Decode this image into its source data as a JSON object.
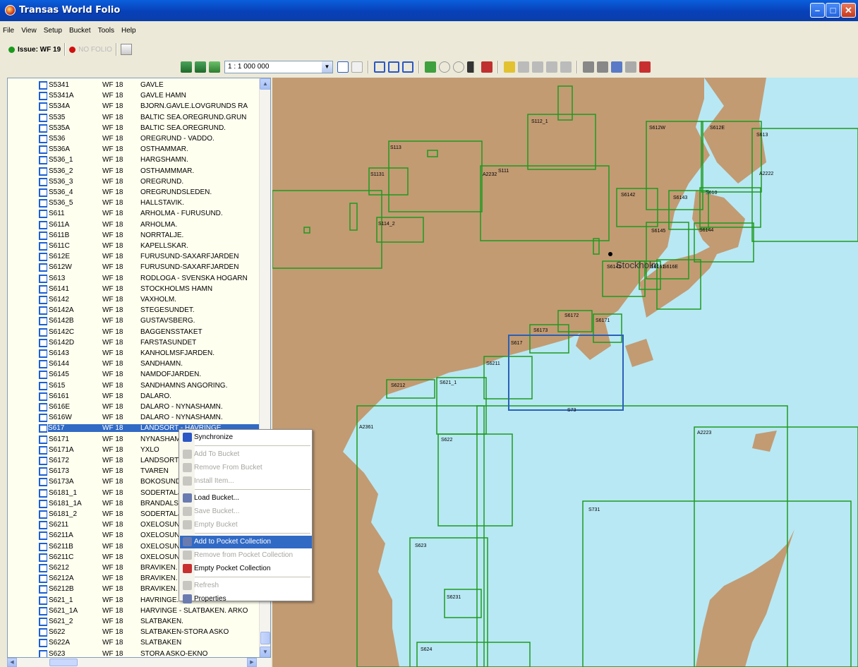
{
  "window": {
    "title": "Transas World Folio"
  },
  "menu": [
    "File",
    "View",
    "Setup",
    "Bucket",
    "Tools",
    "Help"
  ],
  "toolbar": {
    "issue_label": "Issue: WF 19",
    "issue_color": "#1a9a1a",
    "nofolio_label": "NO FOLIO",
    "nofolio_color": "#d01010",
    "scale_value": "1 : 1 000 000"
  },
  "list": {
    "rows": [
      {
        "code": "S5341",
        "ver": "WF 18",
        "name": "GAVLE"
      },
      {
        "code": "S5341A",
        "ver": "WF 18",
        "name": "GAVLE HAMN"
      },
      {
        "code": "S534A",
        "ver": "WF 18",
        "name": "BJORN.GAVLE.LOVGRUNDS RA"
      },
      {
        "code": "S535",
        "ver": "WF 18",
        "name": "BALTIC SEA.OREGRUND.GRUN"
      },
      {
        "code": "S535A",
        "ver": "WF 18",
        "name": "BALTIC SEA.OREGRUND."
      },
      {
        "code": "S536",
        "ver": "WF 18",
        "name": "OREGRUND - VADDO."
      },
      {
        "code": "S536A",
        "ver": "WF 18",
        "name": "OSTHAMMAR."
      },
      {
        "code": "S536_1",
        "ver": "WF 18",
        "name": "HARGSHAMN."
      },
      {
        "code": "S536_2",
        "ver": "WF 18",
        "name": "OSTHAMMMAR."
      },
      {
        "code": "S536_3",
        "ver": "WF 18",
        "name": "OREGRUND."
      },
      {
        "code": "S536_4",
        "ver": "WF 18",
        "name": "OREGRUNDSLEDEN."
      },
      {
        "code": "S536_5",
        "ver": "WF 18",
        "name": "HALLSTAVIK."
      },
      {
        "code": "S611",
        "ver": "WF 18",
        "name": "ARHOLMA - FURUSUND."
      },
      {
        "code": "S611A",
        "ver": "WF 18",
        "name": "ARHOLMA."
      },
      {
        "code": "S611B",
        "ver": "WF 18",
        "name": "NORRTALJE."
      },
      {
        "code": "S611C",
        "ver": "WF 18",
        "name": "KAPELLSKAR."
      },
      {
        "code": "S612E",
        "ver": "WF 18",
        "name": "FURUSUND-SAXARFJARDEN"
      },
      {
        "code": "S612W",
        "ver": "WF 18",
        "name": "FURUSUND-SAXARFJARDEN"
      },
      {
        "code": "S613",
        "ver": "WF 18",
        "name": "RODLOGA - SVENSKA HOGARN"
      },
      {
        "code": "S6141",
        "ver": "WF 18",
        "name": "STOCKHOLMS HAMN"
      },
      {
        "code": "S6142",
        "ver": "WF 18",
        "name": "VAXHOLM."
      },
      {
        "code": "S6142A",
        "ver": "WF 18",
        "name": "STEGESUNDET."
      },
      {
        "code": "S6142B",
        "ver": "WF 18",
        "name": "GUSTAVSBERG."
      },
      {
        "code": "S6142C",
        "ver": "WF 18",
        "name": "BAGGENSSTAKET"
      },
      {
        "code": "S6142D",
        "ver": "WF 18",
        "name": "FARSTASUNDET"
      },
      {
        "code": "S6143",
        "ver": "WF 18",
        "name": "KANHOLMSFJARDEN."
      },
      {
        "code": "S6144",
        "ver": "WF 18",
        "name": "SANDHAMN."
      },
      {
        "code": "S6145",
        "ver": "WF 18",
        "name": "NAMDOFJARDEN."
      },
      {
        "code": "S615",
        "ver": "WF 18",
        "name": "SANDHAMNS ANGORING."
      },
      {
        "code": "S6161",
        "ver": "WF 18",
        "name": "DALARO."
      },
      {
        "code": "S616E",
        "ver": "WF 18",
        "name": "DALARO - NYNASHAMN."
      },
      {
        "code": "S616W",
        "ver": "WF 18",
        "name": "DALARO - NYNASHAMN."
      },
      {
        "code": "S617",
        "ver": "WF 18",
        "name": "LANDSORT - HAVRINGE",
        "selected": true
      },
      {
        "code": "S6171",
        "ver": "WF 18",
        "name": "NYNASHAMN."
      },
      {
        "code": "S6171A",
        "ver": "WF 18",
        "name": "YXLO"
      },
      {
        "code": "S6172",
        "ver": "WF 18",
        "name": "LANDSORT."
      },
      {
        "code": "S6173",
        "ver": "WF 18",
        "name": "TVAREN"
      },
      {
        "code": "S6173A",
        "ver": "WF 18",
        "name": "BOKOSUNDET."
      },
      {
        "code": "S6181_1",
        "ver": "WF 18",
        "name": "SODERTALJE."
      },
      {
        "code": "S6181_1A",
        "ver": "WF 18",
        "name": "BRANDALSUND."
      },
      {
        "code": "S6181_2",
        "ver": "WF 18",
        "name": "SODERTALJE."
      },
      {
        "code": "S6211",
        "ver": "WF 18",
        "name": "OXELOSUND."
      },
      {
        "code": "S6211A",
        "ver": "WF 18",
        "name": "OXELOSUND."
      },
      {
        "code": "S6211B",
        "ver": "WF 18",
        "name": "OXELOSUND."
      },
      {
        "code": "S6211C",
        "ver": "WF 18",
        "name": "OXELOSUND."
      },
      {
        "code": "S6212",
        "ver": "WF 18",
        "name": "BRAVIKEN."
      },
      {
        "code": "S6212A",
        "ver": "WF 18",
        "name": "BRAVIKEN."
      },
      {
        "code": "S6212B",
        "ver": "WF 18",
        "name": "BRAVIKEN."
      },
      {
        "code": "S621_1",
        "ver": "WF 18",
        "name": "HAVRINGE."
      },
      {
        "code": "S621_1A",
        "ver": "WF 18",
        "name": "HARVINGE - SLATBAKEN. ARKO"
      },
      {
        "code": "S621_2",
        "ver": "WF 18",
        "name": "SLATBAKEN."
      },
      {
        "code": "S622",
        "ver": "WF 18",
        "name": "SLATBAKEN-STORA ASKO"
      },
      {
        "code": "S622A",
        "ver": "WF 18",
        "name": "SLATBAKEN"
      },
      {
        "code": "S623",
        "ver": "WF 18",
        "name": "STORA ASKO-EKNO"
      }
    ]
  },
  "context_menu": {
    "items": [
      {
        "label": "Synchronize",
        "disabled": false,
        "icon": "play-icon"
      },
      {
        "label": "Add To Bucket",
        "disabled": true,
        "icon": "bucket-add-icon"
      },
      {
        "label": "Remove From Bucket",
        "disabled": true,
        "icon": "bucket-remove-icon"
      },
      {
        "label": "Install Item...",
        "disabled": true,
        "icon": "install-icon"
      },
      {
        "label": "Load Bucket...",
        "disabled": false,
        "icon": "bucket-load-icon"
      },
      {
        "label": "Save Bucket...",
        "disabled": true,
        "icon": "bucket-save-icon"
      },
      {
        "label": "Empty Bucket",
        "disabled": true,
        "icon": "bucket-empty-icon"
      },
      {
        "label": "Add to Pocket Collection",
        "disabled": false,
        "icon": "pocket-add-icon",
        "highlighted": true
      },
      {
        "label": "Remove from Pocket Collection",
        "disabled": true,
        "icon": "pocket-remove-icon"
      },
      {
        "label": "Empty Pocket Collection",
        "disabled": false,
        "icon": "pocket-empty-icon"
      },
      {
        "label": "Refresh",
        "disabled": true,
        "icon": "refresh-icon"
      },
      {
        "label": "Properties",
        "disabled": false,
        "icon": "properties-icon"
      }
    ]
  },
  "map": {
    "sea_color": "#b8e8f4",
    "land_color": "#c29b73",
    "chart_border_color": "#1e9a1e",
    "selected_border_color": "#2a60b8",
    "city_label": "Stockholm",
    "chart_labels": [
      "S112_1",
      "S113",
      "S1131",
      "A2232",
      "S111",
      "S114_2",
      "S612W",
      "S612E",
      "S613",
      "A2222",
      "S6142",
      "S6143",
      "S610",
      "S6145",
      "S6144",
      "S6141",
      "S6161",
      "S616E",
      "S6172",
      "S6171",
      "S6173",
      "S617",
      "S6211",
      "S6212",
      "S621_1",
      "S73",
      "A2361",
      "S622",
      "A2223",
      "S731",
      "S623",
      "S6231",
      "S624"
    ]
  }
}
